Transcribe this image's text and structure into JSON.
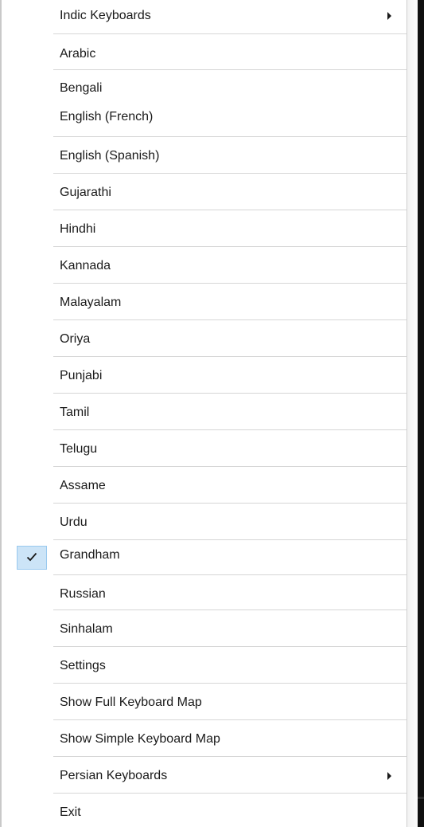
{
  "menu": {
    "items": [
      {
        "label": "Indic Keyboards",
        "submenu": true
      },
      {
        "label": "Arabic"
      },
      {
        "label": "Bengali"
      },
      {
        "label": "English (French)"
      },
      {
        "label": "English (Spanish)"
      },
      {
        "label": "Gujarathi"
      },
      {
        "label": "Hindhi"
      },
      {
        "label": "Kannada"
      },
      {
        "label": "Malayalam"
      },
      {
        "label": "Oriya"
      },
      {
        "label": "Punjabi"
      },
      {
        "label": "Tamil"
      },
      {
        "label": "Telugu"
      },
      {
        "label": "Assame"
      },
      {
        "label": "Urdu"
      },
      {
        "label": "Grandham",
        "checked": true
      },
      {
        "label": "Russian"
      },
      {
        "label": "Sinhalam"
      },
      {
        "label": "Settings"
      },
      {
        "label": "Show Full Keyboard Map"
      },
      {
        "label": "Show Simple Keyboard Map"
      },
      {
        "label": "Persian Keyboards",
        "submenu": true
      },
      {
        "label": "Exit"
      }
    ]
  },
  "icons": {
    "submenu": "chevron-right-icon",
    "checked": "checkmark-icon"
  },
  "colors": {
    "check_highlight": "#cce4f7",
    "check_border": "#99c9ef",
    "divider": "#d6d6d6",
    "text": "#1a1a1a"
  }
}
